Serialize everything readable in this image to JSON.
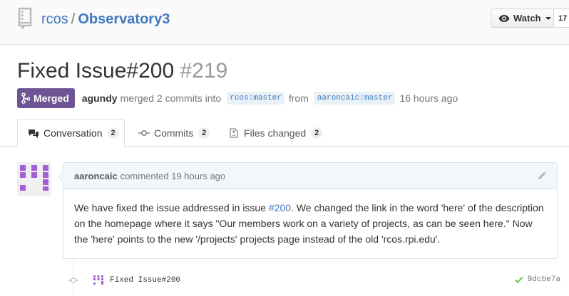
{
  "repo": {
    "owner": "rcos",
    "separator": "/",
    "name": "Observatory3",
    "watch_label": "Watch",
    "watch_count": "17"
  },
  "pr": {
    "title": "Fixed Issue#200",
    "number": "#219",
    "state": "Merged",
    "author": "agundy",
    "action_text": "merged 2 commits into",
    "base_branch": "rcos:master",
    "from_text": "from",
    "head_branch": "aaroncaic:master",
    "time": "16 hours ago"
  },
  "tabs": [
    {
      "label": "Conversation",
      "count": "2",
      "icon": "comment-discussion-icon"
    },
    {
      "label": "Commits",
      "count": "2",
      "icon": "git-commit-icon"
    },
    {
      "label": "Files changed",
      "count": "2",
      "icon": "diff-icon"
    }
  ],
  "comment": {
    "author": "aaroncaic",
    "meta": "commented 19 hours ago",
    "body_part1": "We have fixed the issue addressed in issue ",
    "issue_link": "#200",
    "body_part2": ". We changed the link in the word 'here' of the description on the homepage where it says \"Our members work on a variety of projects, as can be seen here.\" Now the 'here' points to the new '/projects' projects page instead of the old 'rcos.rpi.edu'."
  },
  "commit": {
    "message": "Fixed Issue#200",
    "sha": "9dcbe7a",
    "status": "success"
  },
  "colors": {
    "merged": "#6e5494",
    "link": "#4078c0",
    "avatar": "#a45fd4",
    "success": "#6cc644"
  }
}
